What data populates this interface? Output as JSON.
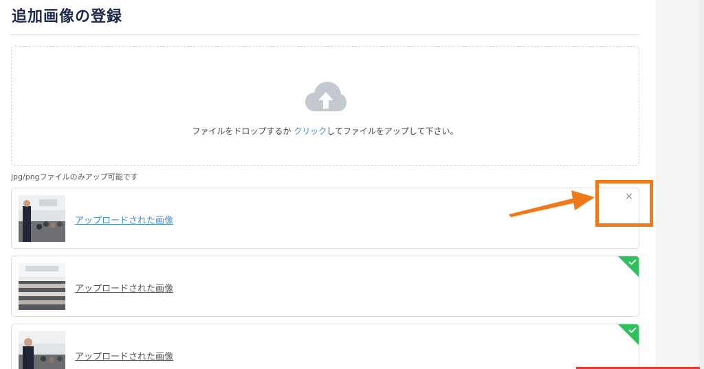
{
  "page": {
    "title": "追加画像の登録"
  },
  "dropzone": {
    "message_before": "ファイルをドロップするか ",
    "click_label": "クリック",
    "message_after": "してファイルをアップして下さい。",
    "icon": "cloud-upload-icon"
  },
  "allowed_types": "jpg/pngファイルのみアップ可能です",
  "files": [
    {
      "label": "アップロードされた画像",
      "status": "uploading",
      "action": "close-icon"
    },
    {
      "label": "アップロードされた画像",
      "status": "success",
      "action": "check-icon"
    },
    {
      "label": "アップロードされた画像",
      "status": "success",
      "action": "check-icon"
    }
  ],
  "remove_symbol": "×",
  "colors": {
    "title": "#1e2a4a",
    "link": "#3f8fd8",
    "success": "#2ec05b",
    "annotation": "#f07a1a",
    "cloud": "#c4c8d0"
  }
}
